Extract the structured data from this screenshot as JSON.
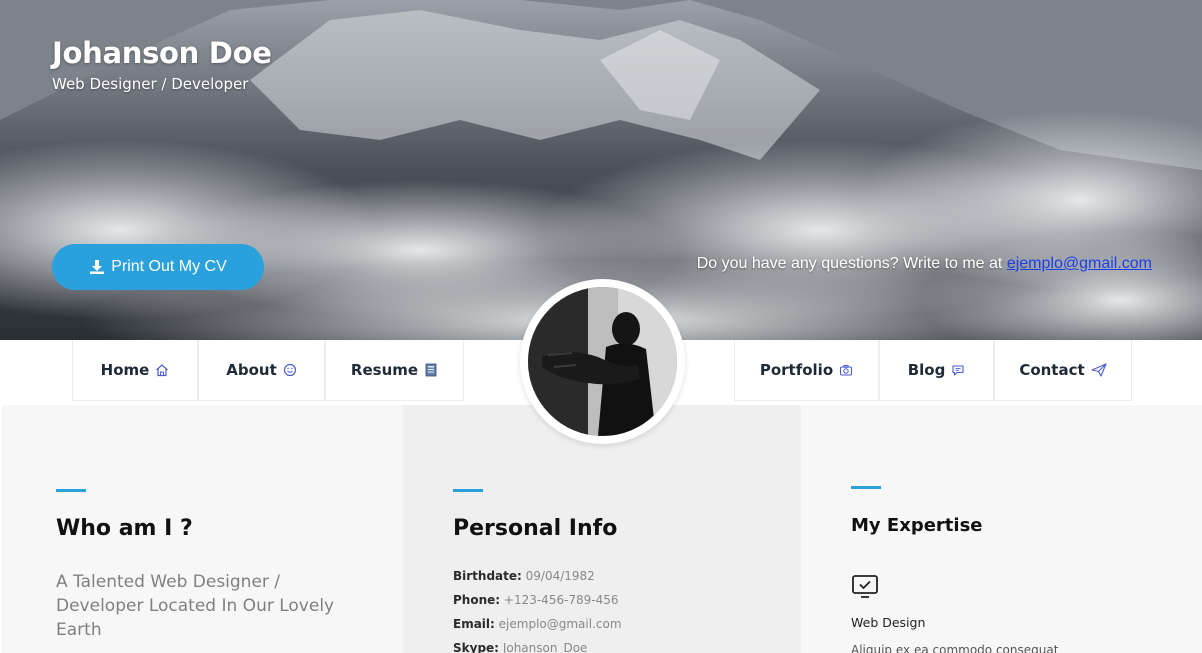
{
  "hero": {
    "name": "Johanson Doe",
    "role": "Web Designer / Developer",
    "cv_button_label": "Print Out My CV",
    "question_text": "Do you have any questions? Write to me at ",
    "email_link": "ejemplo@gmail.com"
  },
  "nav": {
    "items": [
      {
        "label": "Home",
        "icon": "home-icon"
      },
      {
        "label": "About",
        "icon": "smile-icon"
      },
      {
        "label": "Resume",
        "icon": "resume-icon"
      },
      {
        "label": "Portfolio",
        "icon": "camera-icon"
      },
      {
        "label": "Blog",
        "icon": "chat-icon"
      },
      {
        "label": "Contact",
        "icon": "paper-plane-icon"
      }
    ]
  },
  "about": {
    "title": "Who am I ?",
    "description": "A Talented Web Designer / Developer Located In Our Lovely Earth"
  },
  "personal_info": {
    "title": "Personal Info",
    "rows": [
      {
        "key": "Birthdate:",
        "value": "09/04/1982"
      },
      {
        "key": "Phone:",
        "value": "+123-456-789-456"
      },
      {
        "key": "Email:",
        "value": "ejemplo@gmail.com"
      },
      {
        "key": "Skype:",
        "value": "Johanson_Doe"
      }
    ]
  },
  "expertise": {
    "title": "My Expertise",
    "item_title": "Web Design",
    "item_desc": "Aliquip ex ea commodo consequat"
  },
  "colors": {
    "accent": "#2aa1dc",
    "link": "#1a3ee8"
  }
}
